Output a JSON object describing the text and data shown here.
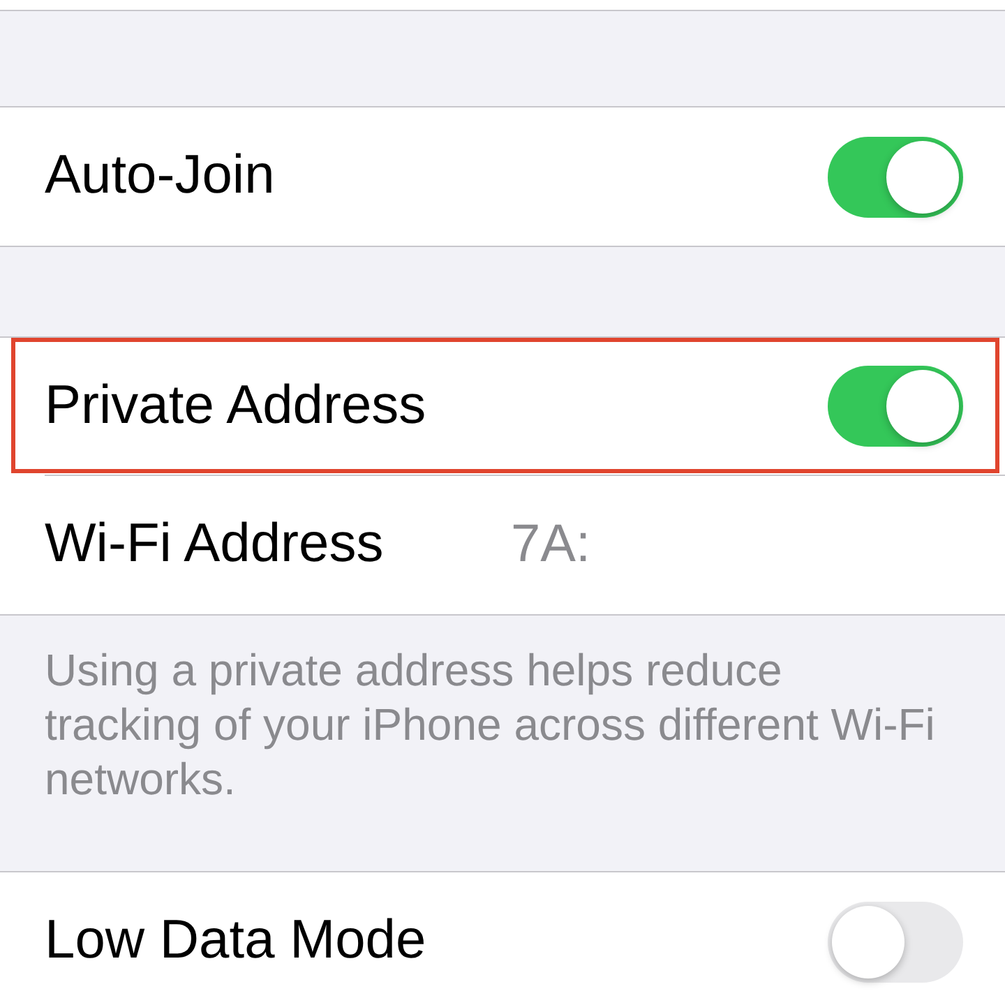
{
  "sections": [
    {
      "rows": [
        {
          "kind": "toggle",
          "label": "Auto-Join",
          "on": true,
          "highlighted": false
        }
      ]
    },
    {
      "rows": [
        {
          "kind": "toggle",
          "label": "Private Address",
          "on": true,
          "highlighted": true
        },
        {
          "kind": "value",
          "label": "Wi-Fi Address",
          "value": "7A:",
          "highlighted": false
        }
      ],
      "footer": "Using a private address helps reduce tracking of your iPhone across different Wi-Fi networks."
    },
    {
      "rows": [
        {
          "kind": "toggle",
          "label": "Low Data Mode",
          "on": false,
          "highlighted": false
        }
      ]
    }
  ]
}
